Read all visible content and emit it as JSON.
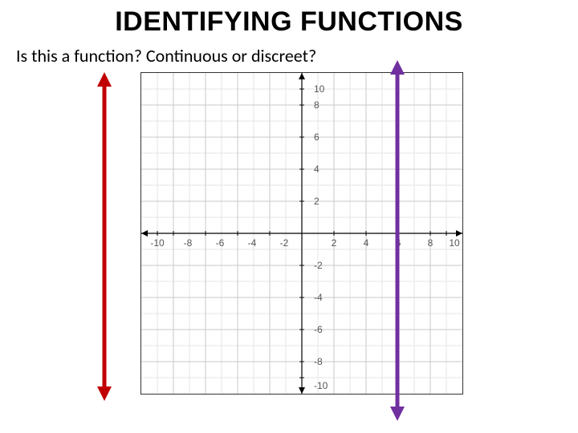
{
  "title": "IDENTIFYING FUNCTIONS",
  "question": "Is this a function? Continuous or discreet?",
  "chart_data": {
    "type": "line",
    "title": "",
    "xlabel": "",
    "ylabel": "",
    "xlim": [
      -10,
      10
    ],
    "ylim": [
      -10,
      10
    ],
    "x_ticks": [
      -10,
      -8,
      -6,
      -4,
      -2,
      2,
      4,
      6,
      8,
      10
    ],
    "y_ticks": [
      -10,
      -8,
      -6,
      -4,
      -2,
      2,
      4,
      6,
      8,
      10
    ],
    "grid": true,
    "series": [
      {
        "name": "vertical-line",
        "x": [
          6,
          6
        ],
        "y": [
          -11,
          11
        ],
        "color": "#7030A0",
        "note": "vertical line at x = 6 (extends beyond axes)"
      }
    ],
    "overlays": [
      {
        "name": "vertical-line-test-marker",
        "x": -12.5,
        "y_range": [
          -11,
          11
        ],
        "color": "#C00000",
        "note": "red double-arrow off-grid to the left"
      }
    ]
  },
  "colors": {
    "grid_minor": "#e6e6e6",
    "grid_major": "#c9c9c9",
    "axis": "#000000",
    "red": "#C00000",
    "purple": "#7030A0",
    "tick_text": "#555555"
  }
}
